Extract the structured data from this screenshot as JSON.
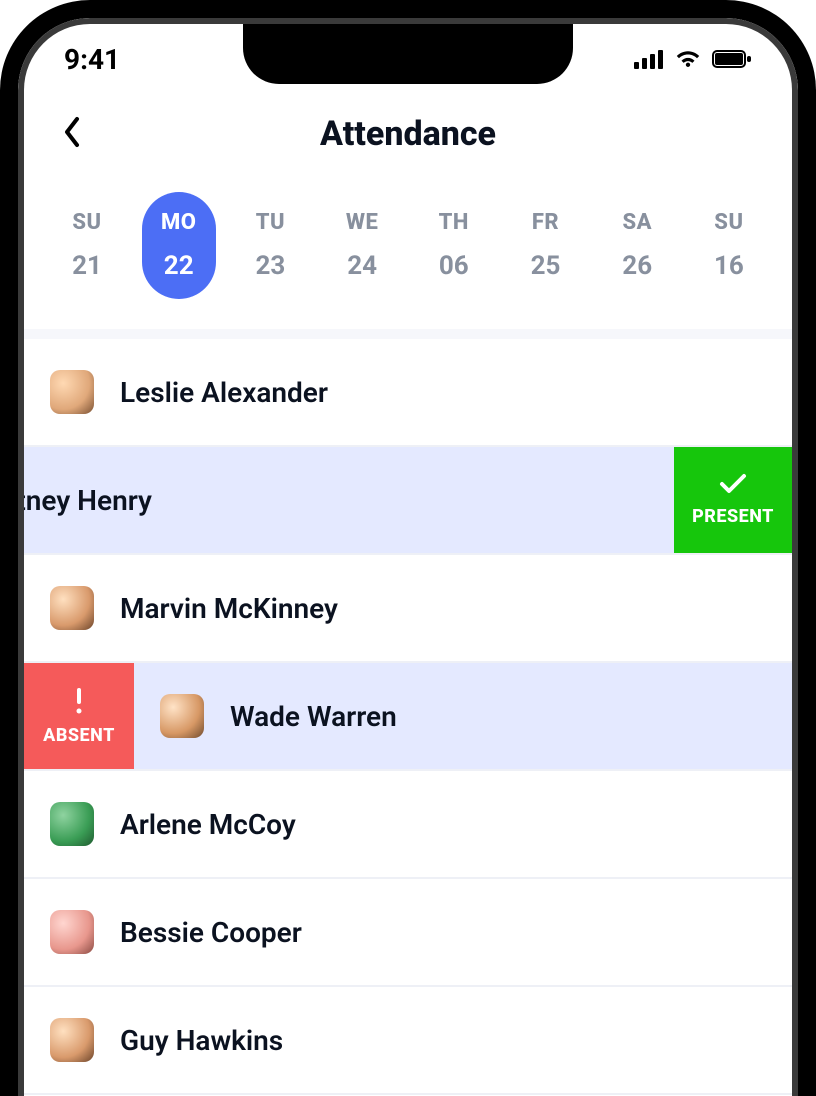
{
  "status": {
    "time": "9:41"
  },
  "header": {
    "title": "Attendance"
  },
  "week": [
    {
      "label": "SU",
      "num": "21",
      "selected": false
    },
    {
      "label": "MO",
      "num": "22",
      "selected": true
    },
    {
      "label": "TU",
      "num": "23",
      "selected": false
    },
    {
      "label": "WE",
      "num": "24",
      "selected": false
    },
    {
      "label": "TH",
      "num": "06",
      "selected": false
    },
    {
      "label": "FR",
      "num": "25",
      "selected": false
    },
    {
      "label": "SA",
      "num": "26",
      "selected": false
    },
    {
      "label": "SU",
      "num": "16",
      "selected": false
    }
  ],
  "students": [
    {
      "name": "Leslie Alexander",
      "state": "none",
      "avatar": "av0"
    },
    {
      "name": "urtney Henry",
      "state": "present",
      "avatar": ""
    },
    {
      "name": "Marvin McKinney",
      "state": "none",
      "avatar": "av1"
    },
    {
      "name": "Wade Warren",
      "state": "absent",
      "avatar": "av2"
    },
    {
      "name": "Arlene McCoy",
      "state": "none",
      "avatar": "av3"
    },
    {
      "name": "Bessie Cooper",
      "state": "none",
      "avatar": "av4"
    },
    {
      "name": "Guy Hawkins",
      "state": "none",
      "avatar": "av5"
    }
  ],
  "actions": {
    "present_label": "PRESENT",
    "absent_label": "ABSENT"
  }
}
